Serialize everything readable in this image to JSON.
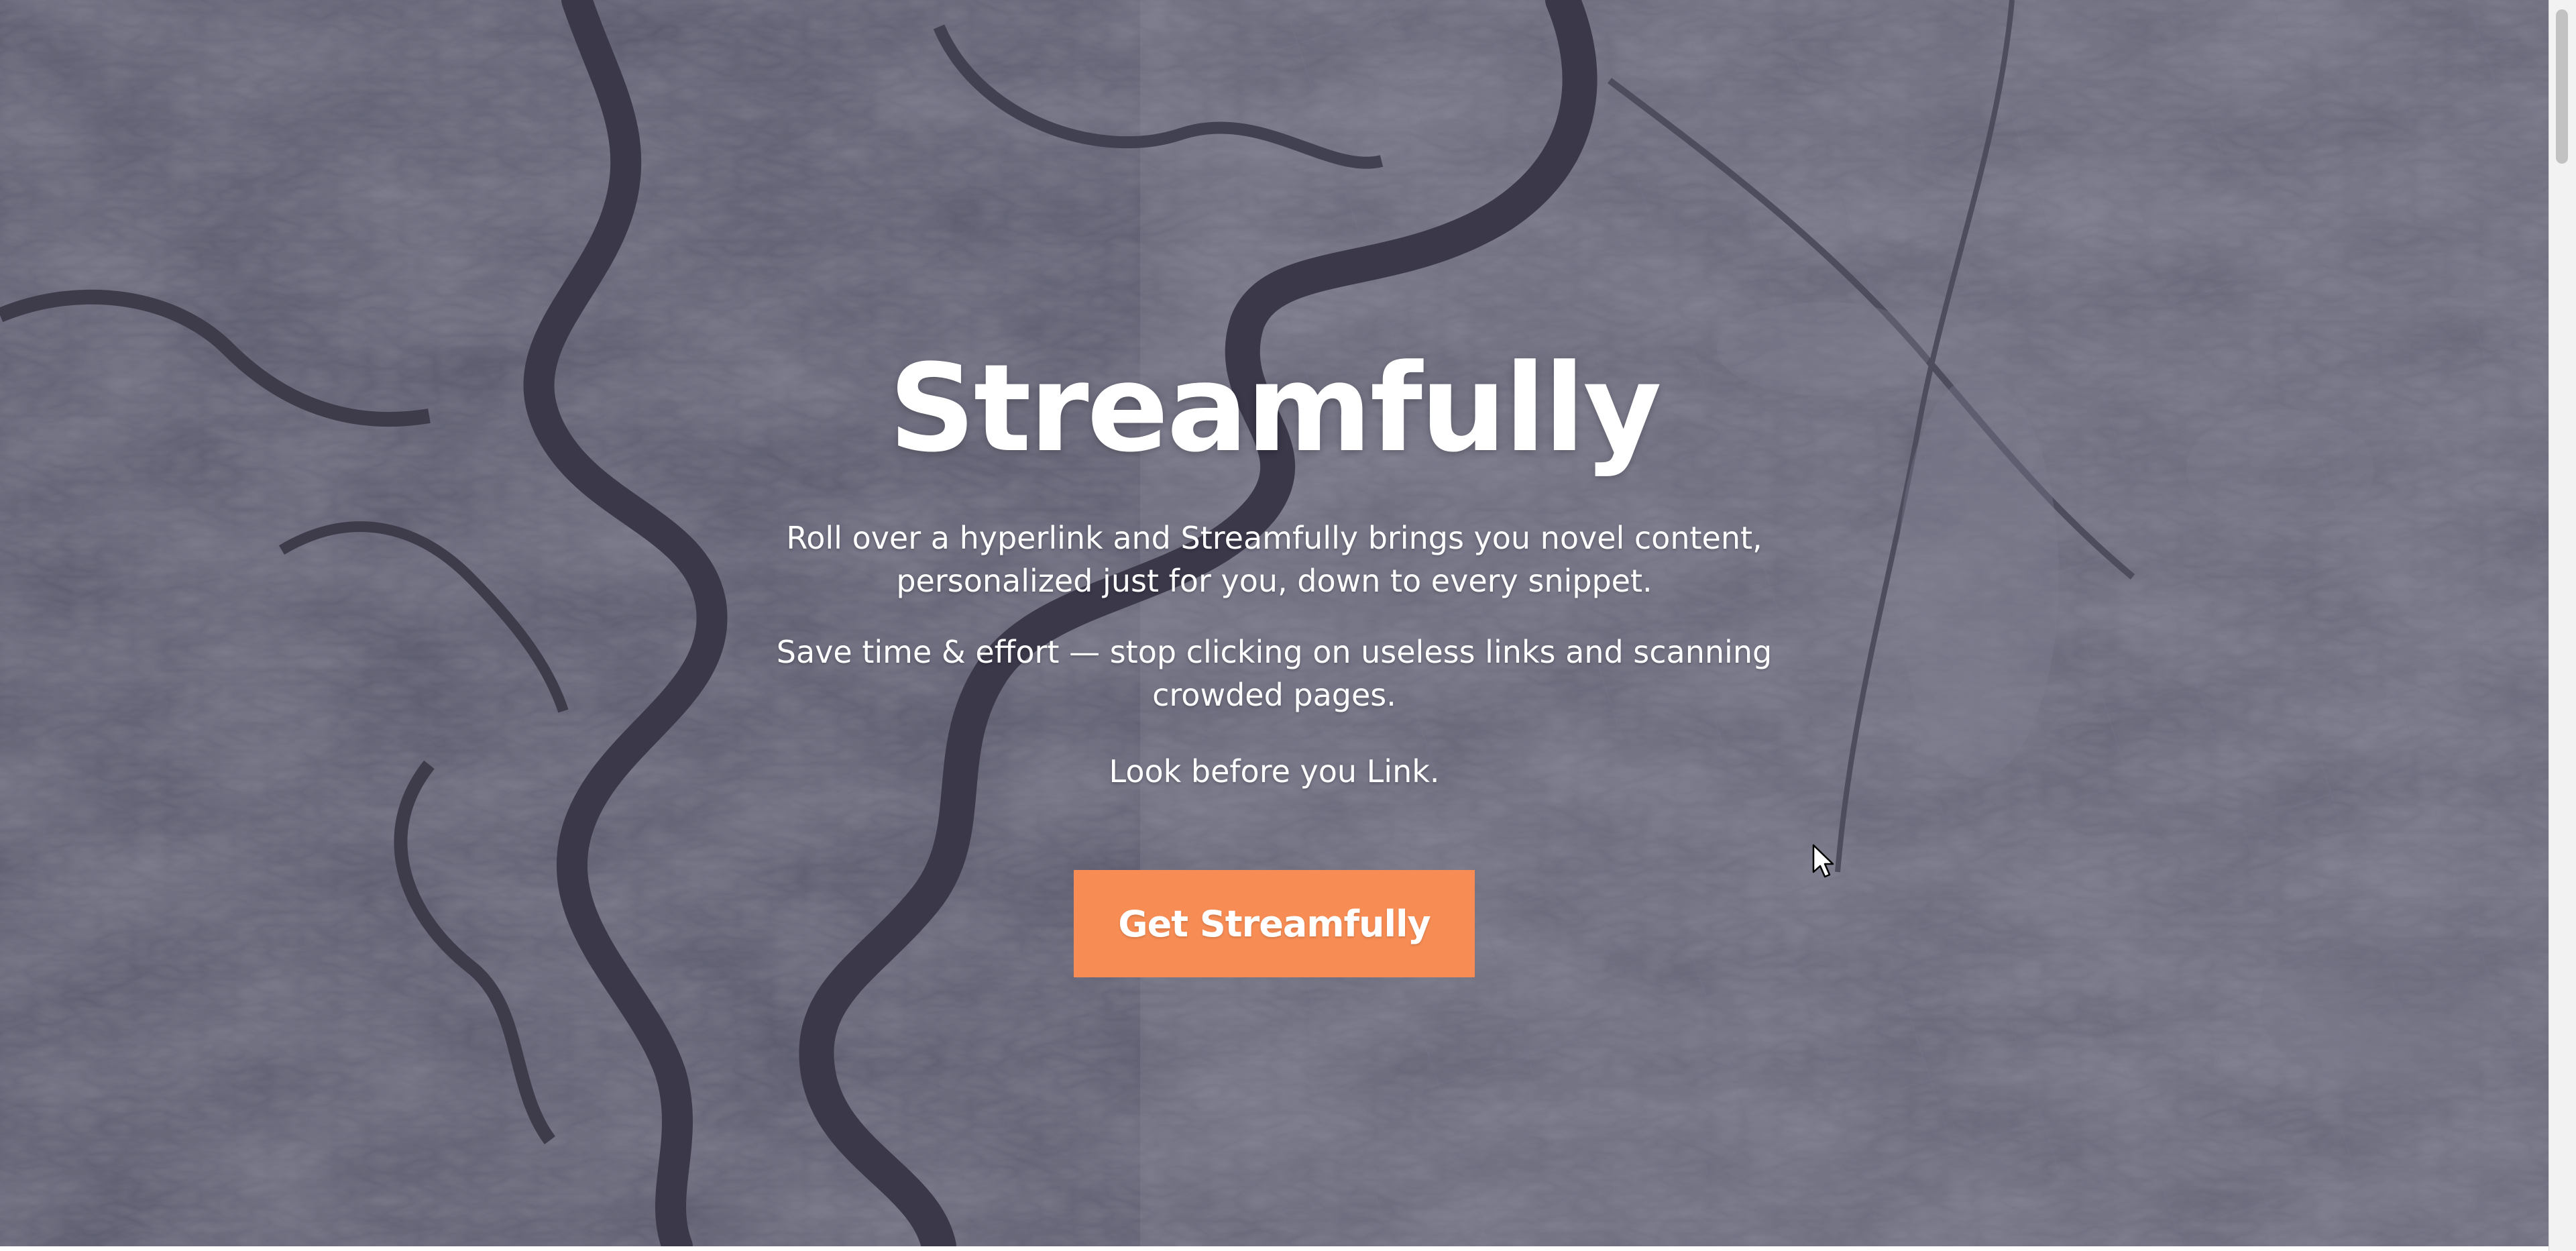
{
  "hero": {
    "title": "Streamfully",
    "paragraphs": [
      "Roll over a hyperlink and Streamfully brings you novel content, personalized just for you, down to every snippet.",
      "Save time & effort — stop clicking on useless links and scanning crowded pages.",
      "Look before you Link."
    ],
    "cta_label": "Get Streamfully",
    "background": "satellite-river-map"
  },
  "colors": {
    "overlay": "#5d5d70",
    "title_text": "#ffffff",
    "cta_background": "#f78c54",
    "cta_text": "#ffffff",
    "river": "#2e2c3c"
  },
  "icons": {
    "cursor": "mouse-pointer-icon"
  }
}
